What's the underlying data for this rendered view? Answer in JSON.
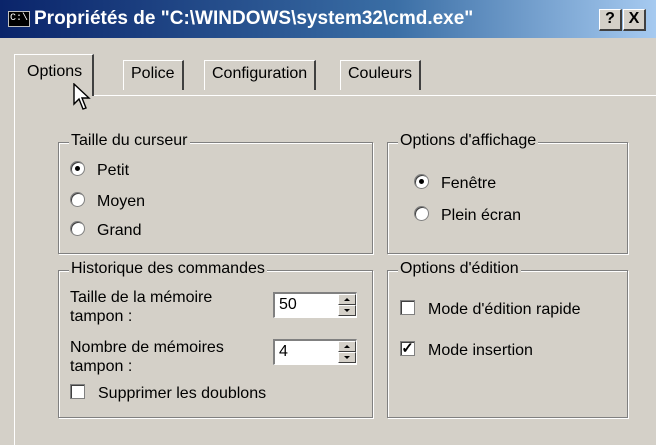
{
  "window": {
    "title": "Propriétés de \"C:\\WINDOWS\\system32\\cmd.exe\"",
    "app_icon": "cmd-icon",
    "help_label": "?",
    "close_label": "X"
  },
  "tabs": [
    {
      "label": "Options",
      "active": true
    },
    {
      "label": "Police",
      "active": false
    },
    {
      "label": "Configuration",
      "active": false
    },
    {
      "label": "Couleurs",
      "active": false
    }
  ],
  "cursor_size": {
    "title": "Taille du curseur",
    "options": [
      {
        "label": "Petit",
        "selected": true
      },
      {
        "label": "Moyen",
        "selected": false
      },
      {
        "label": "Grand",
        "selected": false
      }
    ]
  },
  "display_options": {
    "title": "Options d'affichage",
    "options": [
      {
        "label": "Fenêtre",
        "selected": true
      },
      {
        "label": "Plein écran",
        "selected": false
      }
    ]
  },
  "history": {
    "title": "Historique des commandes",
    "buffer_size_label": [
      "Taille de la mémoire",
      "tampon :"
    ],
    "buffer_size_value": "50",
    "buffer_count_label": [
      "Nombre de mémoires",
      "tampon :"
    ],
    "buffer_count_value": "4",
    "discard_duplicates": {
      "label": "Supprimer les doublons",
      "checked": false
    }
  },
  "edit_options": {
    "title": "Options d'édition",
    "quick_edit": {
      "label": "Mode d'édition rapide",
      "checked": false
    },
    "insert_mode": {
      "label": "Mode insertion",
      "checked": true
    }
  }
}
